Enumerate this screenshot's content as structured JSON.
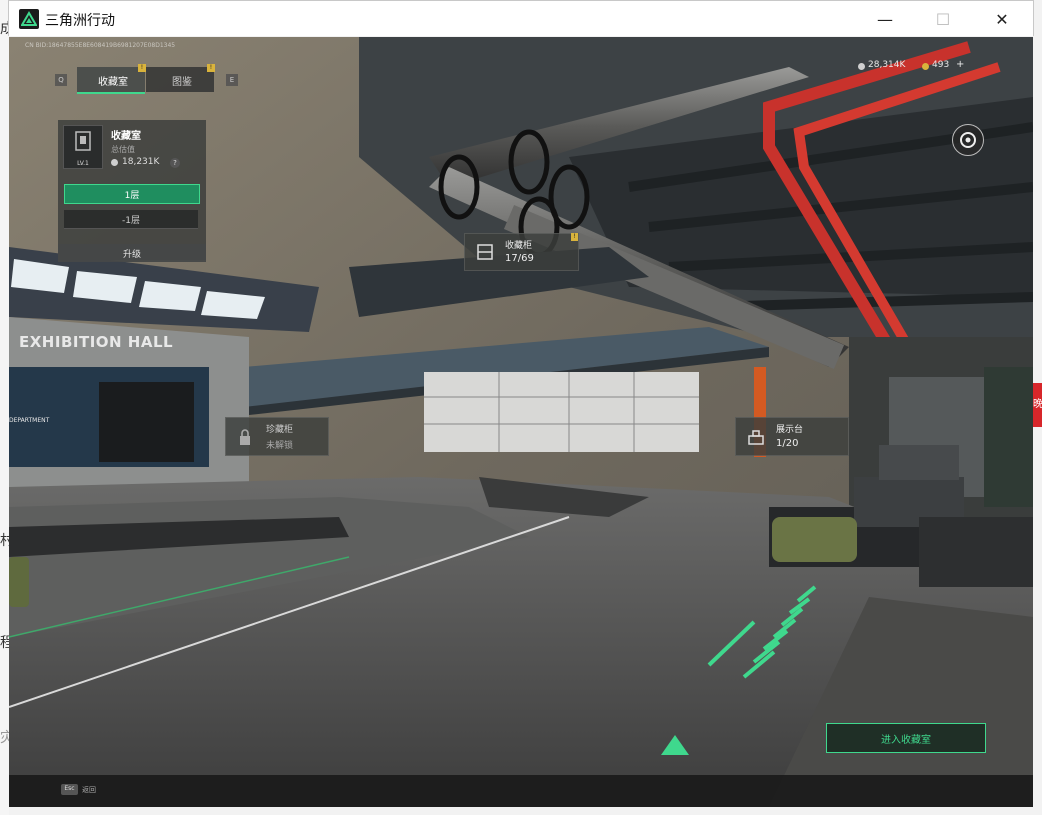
{
  "window": {
    "title": "三角洲行动",
    "controls": {
      "minimize": "—",
      "maximize": "☐",
      "close": "✕"
    }
  },
  "left_edge_chars": [
    "成",
    "村",
    "程",
    "灾"
  ],
  "right_edge_badge": "晚",
  "hud": {
    "build_id": "CN BID:18647855E8E608419B6981207E08D1345",
    "tabs": [
      {
        "label": "收藏室",
        "active": true,
        "alert": "!"
      },
      {
        "label": "图鉴",
        "active": false,
        "alert": "!"
      }
    ],
    "tab_prev_key": "Q",
    "tab_next_key": "E",
    "room_panel": {
      "name": "收藏室",
      "value_label": "总估值",
      "value": "18,231K",
      "help": "?",
      "level": "LV.1",
      "btn_floor1": "1层",
      "btn_floor_minus1": "-1层",
      "upgrade": "升级"
    },
    "currency": {
      "coins": "28,314K",
      "tickets": "493",
      "add": "+"
    }
  },
  "world_tags": [
    {
      "id": "cabinet",
      "title": "收藏柜",
      "count": "17/69",
      "alert": "!"
    },
    {
      "id": "vault",
      "title": "珍藏柜",
      "count": "未解锁"
    },
    {
      "id": "display",
      "title": "展示台",
      "count": "1/20"
    }
  ],
  "scene_text": {
    "hall_sign": "EXHIBITION HALL",
    "wall_sign": "DEPARTMENT"
  },
  "enter_button": "进入收藏室",
  "bottom_bar": {
    "key": "Esc",
    "label": "返回"
  },
  "colors": {
    "accent_green": "#3fd88d",
    "alert_gold": "#d9b33c",
    "pipe_red": "#c8322c"
  }
}
